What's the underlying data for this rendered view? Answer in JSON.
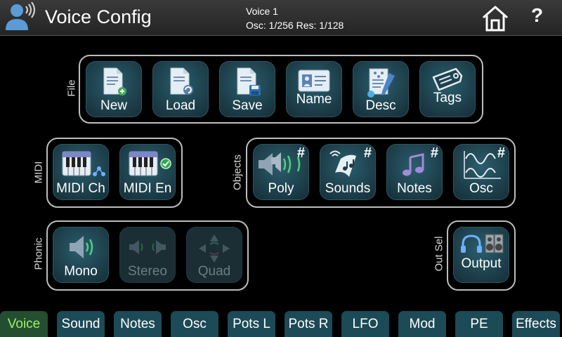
{
  "header": {
    "title": "Voice Config",
    "voice": "Voice 1",
    "osc_res": "Osc: 1/256 Res: 1/128",
    "help": "?"
  },
  "groups": {
    "file": {
      "label": "File",
      "buttons": [
        {
          "label": "New",
          "icon": "new-document-icon"
        },
        {
          "label": "Load",
          "icon": "load-document-icon"
        },
        {
          "label": "Save",
          "icon": "save-document-icon"
        },
        {
          "label": "Name",
          "icon": "name-card-icon"
        },
        {
          "label": "Desc",
          "icon": "description-icon"
        },
        {
          "label": "Tags",
          "icon": "tag-icon"
        }
      ]
    },
    "midi": {
      "label": "MIDI",
      "buttons": [
        {
          "label": "MIDI Ch",
          "icon": "keyboard-channel-icon"
        },
        {
          "label": "MIDI En",
          "icon": "keyboard-enabled-icon"
        }
      ]
    },
    "objects": {
      "label": "Objects",
      "hash": "#",
      "buttons": [
        {
          "label": "Poly",
          "icon": "poly-speaker-icon"
        },
        {
          "label": "Sounds",
          "icon": "sounds-icon"
        },
        {
          "label": "Notes",
          "icon": "music-notes-icon"
        },
        {
          "label": "Osc",
          "icon": "waveform-icon"
        }
      ]
    },
    "phonic": {
      "label": "Phonic",
      "buttons": [
        {
          "label": "Mono",
          "icon": "speaker-icon",
          "enabled": true
        },
        {
          "label": "Stereo",
          "icon": "stereo-icon",
          "enabled": false
        },
        {
          "label": "Quad",
          "icon": "quad-icon",
          "enabled": false
        }
      ]
    },
    "outsel": {
      "label": "Out Sel",
      "buttons": [
        {
          "label": "Output",
          "icon": "headphones-speaker-icon"
        }
      ]
    }
  },
  "tabs": [
    {
      "label": "Voice",
      "active": true
    },
    {
      "label": "Sound"
    },
    {
      "label": "Notes"
    },
    {
      "label": "Osc"
    },
    {
      "label": "Pots L"
    },
    {
      "label": "Pots R"
    },
    {
      "label": "LFO"
    },
    {
      "label": "Mod"
    },
    {
      "label": "PE"
    },
    {
      "label": "Effects"
    }
  ],
  "colors": {
    "button_bg": "#1b3b46",
    "tab_bg": "#1c4a57",
    "tab_active_bg": "#244e30",
    "tab_active_text": "#9cf06a",
    "group_border": "#bdbdbd"
  }
}
